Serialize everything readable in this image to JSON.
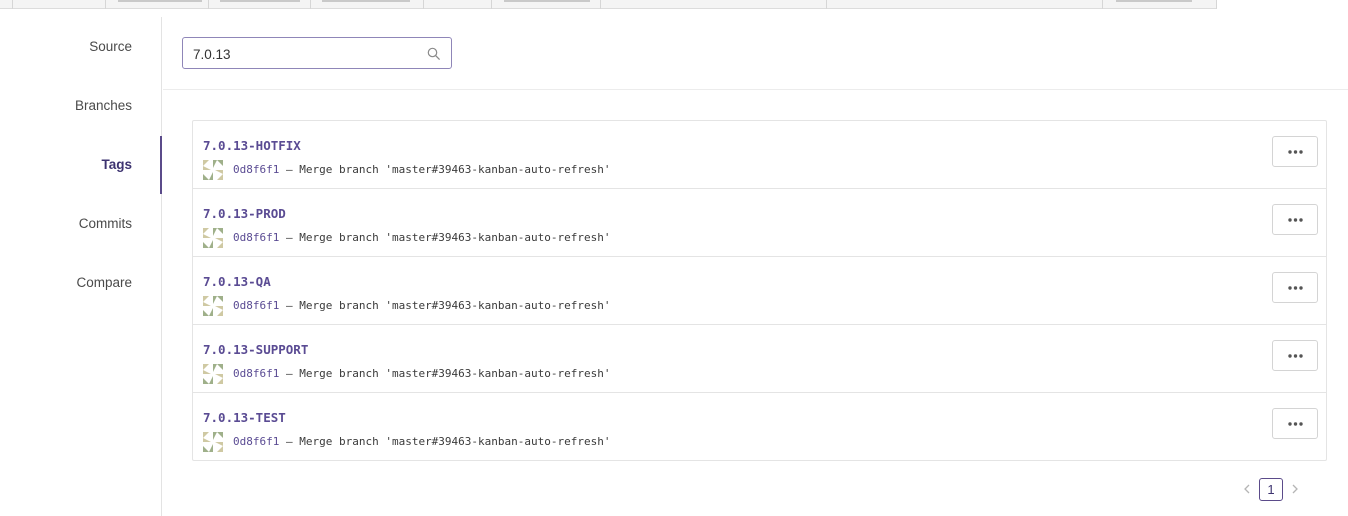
{
  "sidebar": {
    "items": [
      {
        "label": "Source",
        "active": false
      },
      {
        "label": "Branches",
        "active": false
      },
      {
        "label": "Tags",
        "active": true
      },
      {
        "label": "Commits",
        "active": false
      },
      {
        "label": "Compare",
        "active": false
      }
    ]
  },
  "search": {
    "value": "7.0.13",
    "icon": "search-icon"
  },
  "tags": [
    {
      "name": "7.0.13-HOTFIX",
      "hash": "0d8f6f1",
      "separator": "–",
      "message": "Merge branch 'master#39463-kanban-auto-refresh'"
    },
    {
      "name": "7.0.13-PROD",
      "hash": "0d8f6f1",
      "separator": "–",
      "message": "Merge branch 'master#39463-kanban-auto-refresh'"
    },
    {
      "name": "7.0.13-QA",
      "hash": "0d8f6f1",
      "separator": "–",
      "message": "Merge branch 'master#39463-kanban-auto-refresh'"
    },
    {
      "name": "7.0.13-SUPPORT",
      "hash": "0d8f6f1",
      "separator": "–",
      "message": "Merge branch 'master#39463-kanban-auto-refresh'"
    },
    {
      "name": "7.0.13-TEST",
      "hash": "0d8f6f1",
      "separator": "–",
      "message": "Merge branch 'master#39463-kanban-auto-refresh'"
    }
  ],
  "pagination": {
    "current_page": "1"
  },
  "colors": {
    "accent": "#5a4b93",
    "border": "#e4e4e4",
    "avatar_tan": "#cfc9a3",
    "avatar_green": "#9fb08a"
  }
}
